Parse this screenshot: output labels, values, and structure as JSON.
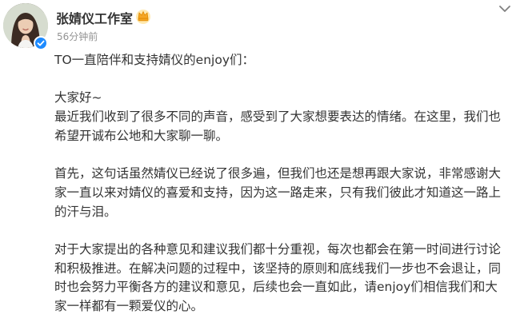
{
  "author": {
    "name": "张婧仪工作室",
    "badge_icon": "vip-crown-icon",
    "verified_icon": "verified-badge-icon",
    "verified_color": "#1e8bff"
  },
  "timestamp": "56分钟前",
  "menu_icon": "chevron-down-icon",
  "post": {
    "lines": [
      "TO一直陪伴和支持婧仪的enjoy们：",
      "",
      "大家好~",
      "最近我们收到了很多不同的声音，感受到了大家想要表达的情绪。在这里，我们也",
      "希望开诚布公地和大家聊一聊。",
      "",
      "首先，这句话虽然婧仪已经说了很多遍，但我们也还是想再跟大家说，非常感谢大",
      "家一直以来对婧仪的喜爱和支持，因为这一路走来，只有我们彼此才知道这一路上",
      "的汗与泪。",
      "",
      "对于大家提出的各种意见和建议我们都十分重视，每次也都会在第一时间进行讨论",
      "和积极推进。在解决问题的过程中，该坚持的原则和底线我们一步也不会退让，同",
      "时也会努力平衡各方的建议和意见，后续也会一直如此，请enjoy们相信我们和大",
      "家一样都有一颗爱仪的心。"
    ]
  }
}
